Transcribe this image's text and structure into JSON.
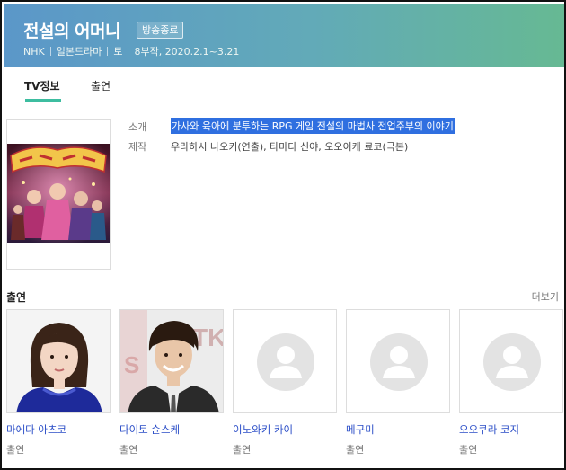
{
  "header": {
    "title": "전설의 어머니",
    "badge": "방송종료",
    "meta": [
      "NHK",
      "일본드라마",
      "토",
      "8부작, 2020.2.1~3.21"
    ]
  },
  "tabs": [
    {
      "label": "TV정보",
      "active": true
    },
    {
      "label": "출연",
      "active": false
    }
  ],
  "info": {
    "intro_label": "소개",
    "intro_value": "가사와 육아에 분투하는 RPG 게임 전설의 마법사 전업주부의 이야기",
    "production_label": "제작",
    "production_value": "우라하시 나오키(연출), 타마다 신야, 오오이케 료코(극본)"
  },
  "cast_section": {
    "title": "출연",
    "more": "더보기",
    "members": [
      {
        "name": "마에다 아츠코",
        "role": "출연",
        "photo": "actress-photo"
      },
      {
        "name": "다이토 슌스케",
        "role": "출연",
        "photo": "actor-photo"
      },
      {
        "name": "이노와키 카이",
        "role": "출연",
        "photo": "placeholder-avatar"
      },
      {
        "name": "메구미",
        "role": "출연",
        "photo": "placeholder-avatar"
      },
      {
        "name": "오오쿠라 코지",
        "role": "출연",
        "photo": "placeholder-avatar"
      }
    ]
  },
  "colors": {
    "header_start": "#5b97c9",
    "header_end": "#66b993",
    "tab_accent": "#3dbda0",
    "link": "#2a4dc7",
    "selection": "#2f6fe0"
  }
}
